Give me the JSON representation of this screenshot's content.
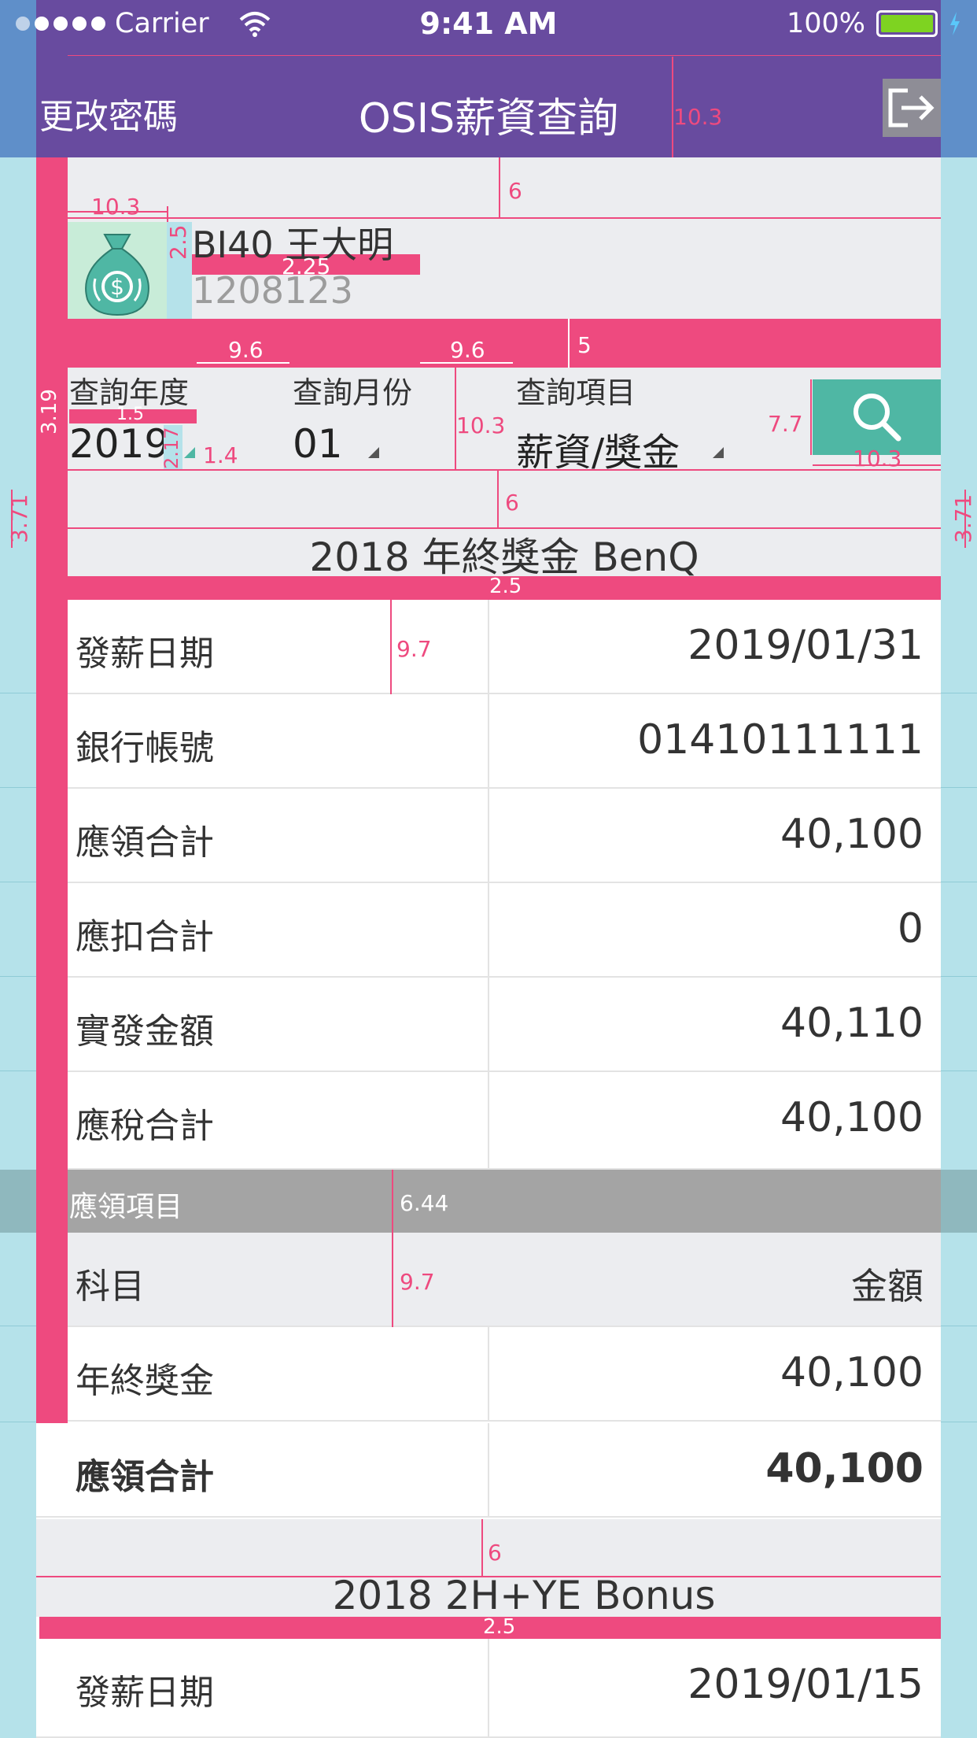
{
  "status_bar": {
    "carrier": "Carrier",
    "time": "9:41 AM",
    "battery": "100%"
  },
  "nav": {
    "left_label": "更改密碼",
    "title": "OSIS薪資查詢"
  },
  "employee": {
    "name": "BI40 王大明",
    "id": "1208123"
  },
  "query": {
    "year_label": "查詢年度",
    "year_value": "2019",
    "month_label": "查詢月份",
    "month_value": "01",
    "item_label": "查詢項目",
    "item_value": "薪資/獎金"
  },
  "section1": {
    "title": "2018 年終獎金 BenQ",
    "rows": [
      {
        "label": "發薪日期",
        "value": "2019/01/31"
      },
      {
        "label": "銀行帳號",
        "value": "01410111111"
      },
      {
        "label": "應領合計",
        "value": "40,100"
      },
      {
        "label": "應扣合計",
        "value": "0"
      },
      {
        "label": "實發金額",
        "value": "40,110"
      },
      {
        "label": "應稅合計",
        "value": "40,100"
      }
    ],
    "subheader": "應領項目",
    "table_header": {
      "label": "科目",
      "value": "金額"
    },
    "items": [
      {
        "label": "年終獎金",
        "value": "40,100"
      }
    ],
    "total": {
      "label": "應領合計",
      "value": "40,100"
    }
  },
  "section2": {
    "title": "2018 2H+YE Bonus",
    "rows": [
      {
        "label": "發薪日期",
        "value": "2019/01/15"
      }
    ]
  },
  "annotations": {
    "a1": "10.3",
    "a2": "6",
    "a3": "10.3",
    "a4": "6",
    "a5": "2.25",
    "a6": "2.5",
    "a7": "9.6",
    "a8": "9.6",
    "a9": "5",
    "a10": "3.19",
    "a11": "1.5",
    "a12": "2.17",
    "a13": "1.4",
    "a14": "10.3",
    "a15": "7.7",
    "a16": "10.3",
    "a17": "6",
    "a18": "3.71",
    "a19": "3.71",
    "a20": "2.5",
    "a21": "9.7",
    "a22": "6.44",
    "a23": "9.7",
    "a24": "6",
    "a25": "2.5"
  },
  "colors": {
    "nav_purple": "#684b9f",
    "accent_pink": "#ee4a7f",
    "search_teal": "#4fb7a4",
    "header_grey": "#a4a4a4",
    "guide_blue": "#b5e2ea"
  }
}
